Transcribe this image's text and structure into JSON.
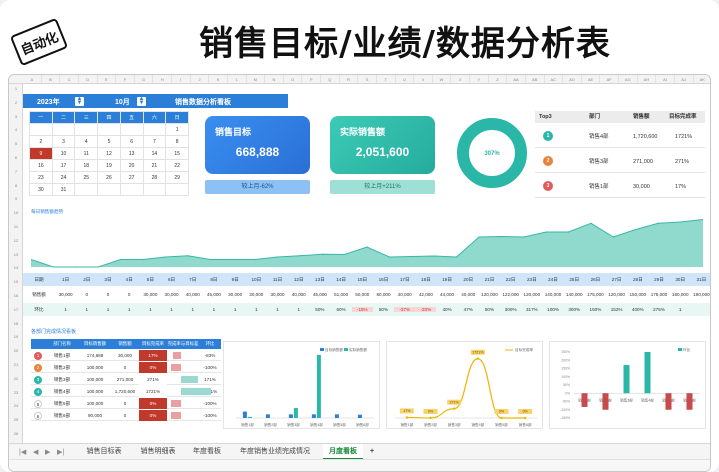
{
  "banner": {
    "stamp": "自动化",
    "title": "销售目标/业绩/数据分析表"
  },
  "columns": [
    "A",
    "B",
    "C",
    "D",
    "E",
    "F",
    "G",
    "H",
    "I",
    "J",
    "K",
    "L",
    "M",
    "N",
    "O",
    "P",
    "Q",
    "R",
    "S",
    "T",
    "U",
    "V",
    "W",
    "X",
    "Y",
    "Z",
    "AA",
    "AB",
    "AC",
    "AD",
    "AE",
    "AF",
    "AG",
    "AH",
    "AI",
    "AJ",
    "AK"
  ],
  "rows": [
    "1",
    "2",
    "3",
    "4",
    "5",
    "6",
    "7",
    "8",
    "9",
    "10",
    "11",
    "12",
    "13",
    "14",
    "15",
    "16",
    "17",
    "18",
    "19",
    "20",
    "21",
    "22",
    "23",
    "24",
    "25",
    "26"
  ],
  "header": {
    "year": "2023年",
    "month": "10月",
    "board_title": "销售数据分析看板"
  },
  "calendar": {
    "weekdays": [
      "一",
      "二",
      "三",
      "四",
      "五",
      "六",
      "日"
    ],
    "weeks": [
      [
        "",
        "",
        "",
        "",
        "",
        "",
        "1"
      ],
      [
        "2",
        "3",
        "4",
        "5",
        "6",
        "7",
        "8"
      ],
      [
        "9",
        "10",
        "11",
        "12",
        "13",
        "14",
        "15"
      ],
      [
        "16",
        "17",
        "18",
        "19",
        "20",
        "21",
        "22"
      ],
      [
        "23",
        "24",
        "25",
        "26",
        "27",
        "28",
        "29"
      ],
      [
        "30",
        "31",
        "",
        "",
        "",
        "",
        ""
      ]
    ],
    "selected": "9"
  },
  "kpi": {
    "target_label": "销售目标",
    "target_value": "668,888",
    "target_compare": "较上月-62%",
    "actual_label": "实际销售额",
    "actual_value": "2,051,600",
    "actual_compare": "较上月+211%"
  },
  "donut": {
    "label": "307%",
    "percent": 100,
    "colors": {
      "fill": "#2bb7a8",
      "track": "#d9f1ee"
    }
  },
  "top3": {
    "headers": [
      "Top3",
      "部门",
      "销售额",
      "目标完成率"
    ],
    "rows": [
      {
        "rank": "1",
        "dept": "销售4部",
        "sales": "1,720,600",
        "rate": "1721%",
        "color": "#2bb7a8"
      },
      {
        "rank": "2",
        "dept": "销售3部",
        "sales": "271,000",
        "rate": "271%",
        "color": "#e8833a"
      },
      {
        "rank": "3",
        "dept": "销售1部",
        "sales": "30,000",
        "rate": "17%",
        "color": "#e25b5b"
      }
    ]
  },
  "daily": {
    "title": "每日销售额趋势",
    "row_labels": [
      "日期",
      "销售额",
      "环比"
    ],
    "days": [
      "1日",
      "2日",
      "3日",
      "4日",
      "5日",
      "6日",
      "7日",
      "8日",
      "9日",
      "10日",
      "11日",
      "12日",
      "13日",
      "14日",
      "15日",
      "16日",
      "17日",
      "18日",
      "19日",
      "20日",
      "21日",
      "22日",
      "23日",
      "24日",
      "25日",
      "26日",
      "27日",
      "28日",
      "29日",
      "30日",
      "31日"
    ],
    "sales": [
      "30,000",
      "0",
      "0",
      "0",
      "30,000",
      "30,000",
      "40,000",
      "45,000",
      "30,000",
      "30,000",
      "30,000",
      "40,000",
      "45,000",
      "51,000",
      "50,000",
      "80,000",
      "40,000",
      "42,000",
      "44,000",
      "40,000",
      "120,000",
      "122,000",
      "120,000",
      "140,000",
      "140,000",
      "175,000",
      "120,000",
      "150,000",
      "175,000",
      "180,000",
      "190,000"
    ],
    "mom": [
      "1",
      "1",
      "1",
      "1",
      "1",
      "1",
      "1",
      "1",
      "1",
      "1",
      "1",
      "1",
      "50%",
      "60%",
      "-15%",
      "50%",
      "-37%",
      "-20%",
      "40%",
      "47%",
      "50%",
      "300%",
      "317%",
      "100%",
      "300%",
      "150%",
      "152%",
      "400%",
      "275%",
      "1",
      ""
    ]
  },
  "chart_data": [
    {
      "type": "area",
      "title": "每日销售额趋势",
      "x": [
        "1日",
        "2日",
        "3日",
        "4日",
        "5日",
        "6日",
        "7日",
        "8日",
        "9日",
        "10日",
        "11日",
        "12日",
        "13日",
        "14日",
        "15日",
        "16日",
        "17日",
        "18日",
        "19日",
        "20日",
        "21日",
        "22日",
        "23日",
        "24日",
        "25日",
        "26日",
        "27日",
        "28日",
        "29日",
        "30日",
        "31日"
      ],
      "y": [
        30000,
        0,
        0,
        0,
        30000,
        30000,
        40000,
        45000,
        30000,
        30000,
        30000,
        40000,
        45000,
        51000,
        50000,
        80000,
        40000,
        42000,
        44000,
        40000,
        120000,
        122000,
        120000,
        140000,
        140000,
        175000,
        120000,
        150000,
        175000,
        180000,
        190000
      ],
      "ylim": [
        0,
        200000
      ],
      "grid": false
    },
    {
      "type": "bar",
      "categories": [
        "销售1部",
        "销售2部",
        "销售3部",
        "销售4部",
        "销售5部",
        "销售6部"
      ],
      "series": [
        {
          "name": "目标销售额",
          "values": [
            174888,
            100000,
            100000,
            100000,
            100000,
            90000
          ]
        },
        {
          "name": "实际销售额",
          "values": [
            30000,
            0,
            271000,
            1720600,
            0,
            0
          ]
        }
      ],
      "legend": "top-right"
    },
    {
      "type": "line",
      "categories": [
        "销售1部",
        "销售2部",
        "销售3部",
        "销售4部",
        "销售5部",
        "销售6部"
      ],
      "series": [
        {
          "name": "目标完成率",
          "values": [
            17,
            0,
            271,
            1721,
            0,
            0
          ]
        }
      ],
      "data_labels": [
        "17%",
        "0%",
        "271%",
        "1721%",
        "0%",
        "0%"
      ],
      "legend": "top-right"
    },
    {
      "type": "bar",
      "categories": [
        "销售1部",
        "销售2部",
        "销售3部",
        "销售4部",
        "销售5部",
        "销售6部"
      ],
      "series": [
        {
          "name": "环比",
          "values": [
            -83,
            -100,
            171,
            1621,
            -100,
            -100
          ]
        }
      ],
      "ylim": [
        -150,
        250
      ],
      "legend": "top-right"
    }
  ],
  "dept_table": {
    "title": "各部门完成情况看板",
    "headers": [
      "",
      "部门名称",
      "目标销售额",
      "销售额",
      "目标完成率",
      "完成率与目标差距",
      "环比"
    ],
    "rows": [
      {
        "rank": "1",
        "dept": "销售1部",
        "target": "174,888",
        "actual": "30,000",
        "rate": "17%",
        "mom": "-83%",
        "color": "#e25b5b"
      },
      {
        "rank": "2",
        "dept": "销售2部",
        "target": "100,000",
        "actual": "0",
        "rate": "0%",
        "mom": "-100%",
        "color": "#e8833a"
      },
      {
        "rank": "3",
        "dept": "销售3部",
        "target": "100,000",
        "actual": "271,000",
        "rate": "271%",
        "mom": "171%",
        "color": "#2bb7a8"
      },
      {
        "rank": "4",
        "dept": "销售4部",
        "target": "100,000",
        "actual": "1,720,600",
        "rate": "1721%",
        "mom": "1621%",
        "color": "#2bb7a8"
      },
      {
        "rank": "5",
        "dept": "销售5部",
        "target": "100,000",
        "actual": "0",
        "rate": "0%",
        "mom": "-100%",
        "color": ""
      },
      {
        "rank": "6",
        "dept": "销售6部",
        "target": "90,000",
        "actual": "0",
        "rate": "0%",
        "mom": "-100%",
        "color": ""
      }
    ]
  },
  "tabs": [
    "销售目标表",
    "销售明细表",
    "年度看板",
    "年度销售业绩完成情况",
    "月度看板"
  ],
  "active_tab": "月度看板",
  "add_tab": "+"
}
